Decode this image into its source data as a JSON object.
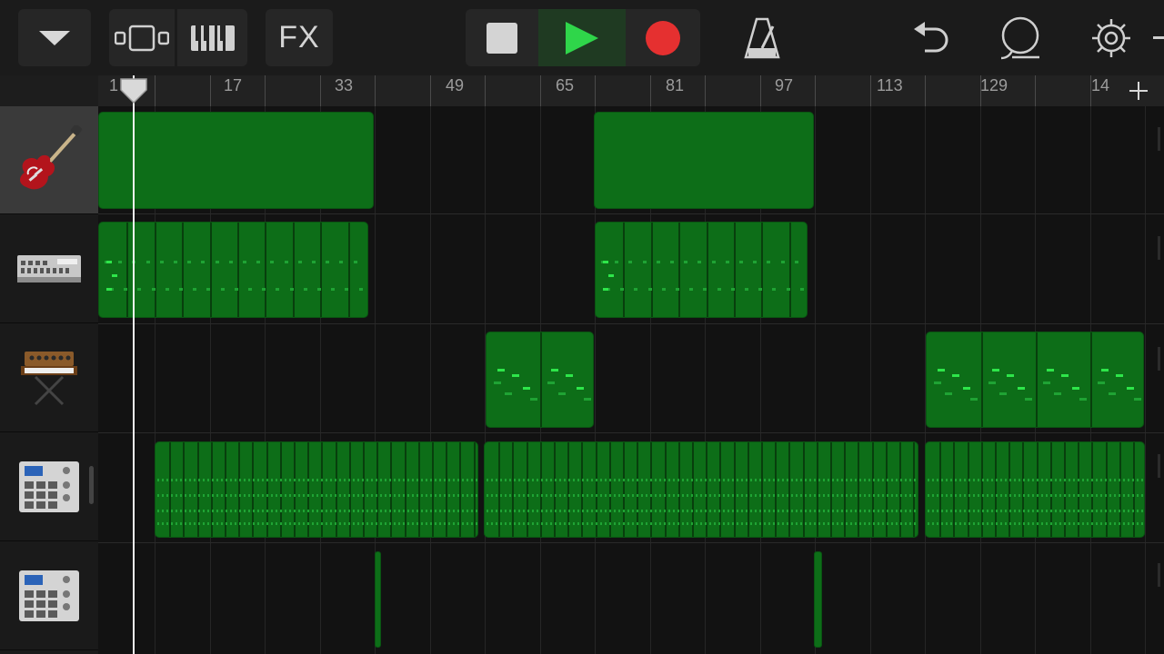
{
  "toolbar": {
    "fx_label": "FX"
  },
  "ruler": {
    "bars": [
      "1",
      "17",
      "33",
      "49",
      "65",
      "81",
      "97",
      "113",
      "129",
      "14"
    ]
  },
  "tracks": [
    {
      "instrument": "electric-guitar",
      "selected": true
    },
    {
      "instrument": "drum-machine",
      "selected": false
    },
    {
      "instrument": "synth-keyboard",
      "selected": false
    },
    {
      "instrument": "beat-sequencer",
      "selected": false
    },
    {
      "instrument": "beat-sequencer",
      "selected": false
    }
  ],
  "colors": {
    "region": "#0d6e18",
    "note": "#2ee64a",
    "play": "#2fd64a",
    "record": "#e53030",
    "playhead": "#f2f2f2"
  },
  "icons": [
    "chevron-down-icon",
    "tracks-view-icon",
    "piano-keys-icon",
    "stop-icon",
    "play-icon",
    "record-icon",
    "metronome-icon",
    "undo-icon",
    "loop-icon",
    "settings-icon",
    "add-icon"
  ]
}
